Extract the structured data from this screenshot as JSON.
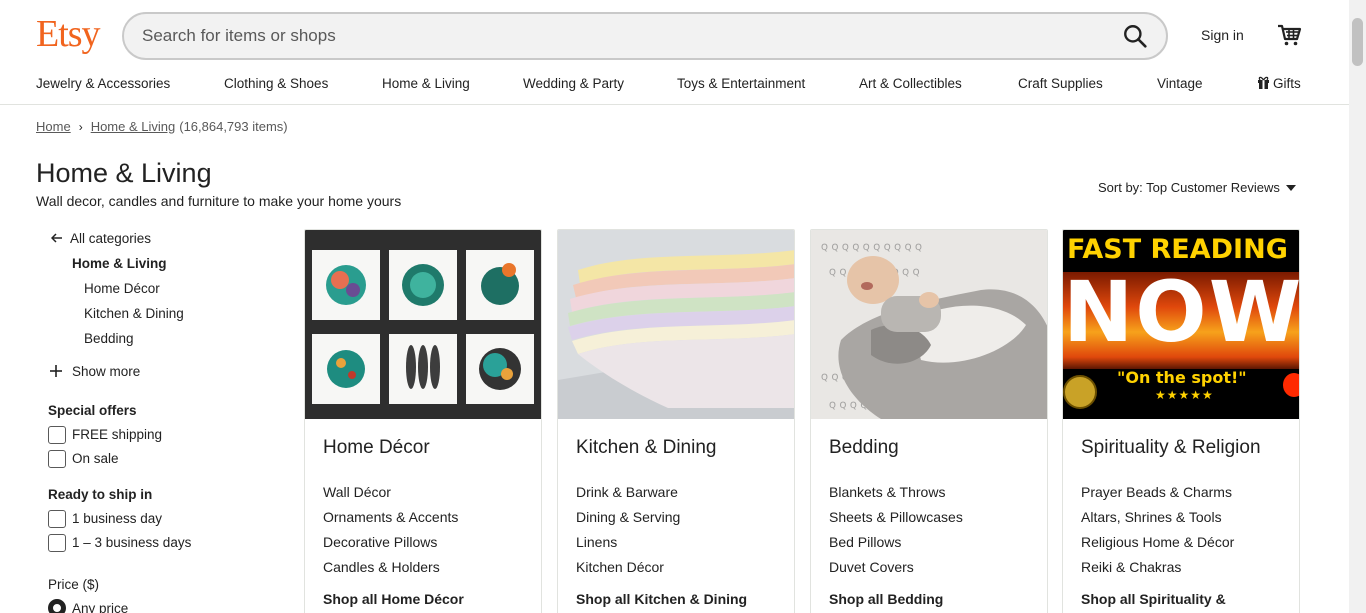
{
  "header": {
    "logo": "Etsy",
    "search_placeholder": "Search for items or shops",
    "sign_in": "Sign in",
    "brand_color": "#f1641e"
  },
  "nav": [
    "Jewelry & Accessories",
    "Clothing & Shoes",
    "Home & Living",
    "Wedding & Party",
    "Toys & Entertainment",
    "Art & Collectibles",
    "Craft Supplies",
    "Vintage",
    "Gifts"
  ],
  "breadcrumb": {
    "home": "Home",
    "current": "Home & Living",
    "count": "(16,864,793 items)"
  },
  "page": {
    "title": "Home & Living",
    "subtitle": "Wall decor, candles and furniture to make your home yours",
    "sort": "Sort by: Top Customer Reviews"
  },
  "sidebar": {
    "all_categories": "All categories",
    "current": "Home & Living",
    "subcategories": [
      "Home Décor",
      "Kitchen & Dining",
      "Bedding"
    ],
    "show_more": "Show more",
    "special_offers": {
      "title": "Special offers",
      "options": [
        "FREE shipping",
        "On sale"
      ]
    },
    "ready_to_ship": {
      "title": "Ready to ship in",
      "options": [
        "1 business day",
        "1 – 3 business days"
      ]
    },
    "price": {
      "title": "Price ($)",
      "selected": "Any price"
    }
  },
  "cards": [
    {
      "title": "Home Décor",
      "links": [
        "Wall Décor",
        "Ornaments & Accents",
        "Decorative Pillows",
        "Candles & Holders"
      ],
      "shop_all": "Shop all Home Décor"
    },
    {
      "title": "Kitchen & Dining",
      "links": [
        "Drink & Barware",
        "Dining & Serving",
        "Linens",
        "Kitchen Décor"
      ],
      "shop_all": "Shop all Kitchen & Dining"
    },
    {
      "title": "Bedding",
      "links": [
        "Blankets & Throws",
        "Sheets & Pillowcases",
        "Bed Pillows",
        "Duvet Covers"
      ],
      "shop_all": "Shop all Bedding"
    },
    {
      "title": "Spirituality & Religion",
      "links": [
        "Prayer Beads & Charms",
        "Altars, Shrines & Tools",
        "Religious Home & Décor",
        "Reiki & Chakras"
      ],
      "shop_all": "Shop all Spirituality & Religion",
      "image_text": {
        "headline": "FAST READING",
        "big": "NOW",
        "tagline": "\"On the spot!\"",
        "stars": "★★★★★"
      }
    }
  ]
}
